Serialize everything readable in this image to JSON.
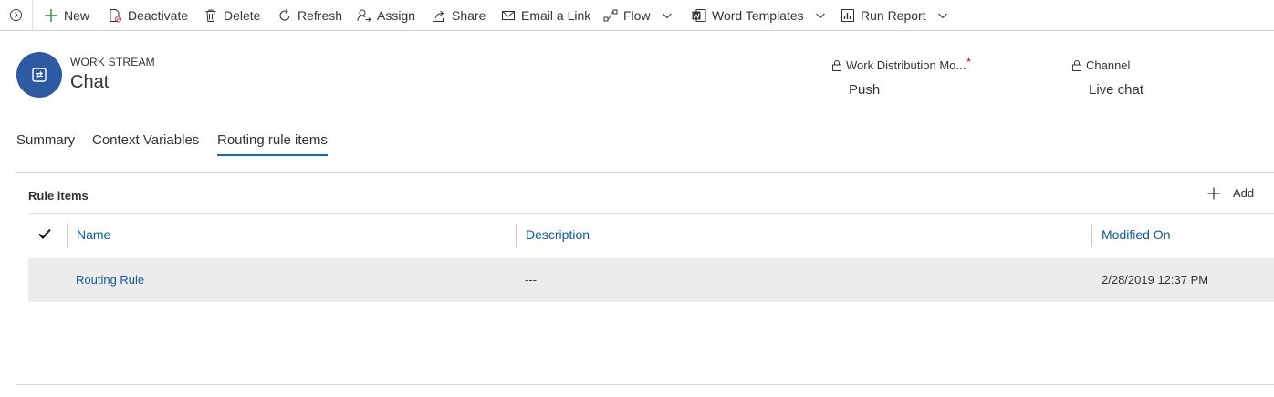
{
  "toolbar": {
    "items": [
      {
        "label": "New",
        "icon": "plus-icon"
      },
      {
        "label": "Deactivate",
        "icon": "deactivate-icon"
      },
      {
        "label": "Delete",
        "icon": "trash-icon"
      },
      {
        "label": "Refresh",
        "icon": "refresh-icon"
      },
      {
        "label": "Assign",
        "icon": "assign-icon"
      },
      {
        "label": "Share",
        "icon": "share-icon"
      },
      {
        "label": "Email a Link",
        "icon": "email-icon"
      },
      {
        "label": "Flow",
        "icon": "flow-icon"
      },
      {
        "label": "Word Templates",
        "icon": "word-icon"
      },
      {
        "label": "Run Report",
        "icon": "report-icon"
      }
    ]
  },
  "header": {
    "entity_type": "WORK STREAM",
    "record_name": "Chat",
    "fields": [
      {
        "label": "Work Distribution Mo...",
        "required_mark": "*",
        "value": "Push"
      },
      {
        "label": "Channel",
        "value": "Live chat"
      }
    ]
  },
  "tabs": [
    {
      "label": "Summary",
      "active": false
    },
    {
      "label": "Context Variables",
      "active": false
    },
    {
      "label": "Routing rule items",
      "active": true
    }
  ],
  "subgrid": {
    "title": "Rule items",
    "add_label": "Add",
    "columns": [
      "Name",
      "Description",
      "Modified On"
    ],
    "rows": [
      {
        "name": "Routing Rule",
        "description": "---",
        "modified_on": "2/28/2019 12:37 PM"
      }
    ]
  },
  "colors": {
    "accent": "#0f6cbd",
    "avatar_bg": "#2e5aa1",
    "link": "#0f5aa0",
    "selected_row": "#ececec"
  }
}
